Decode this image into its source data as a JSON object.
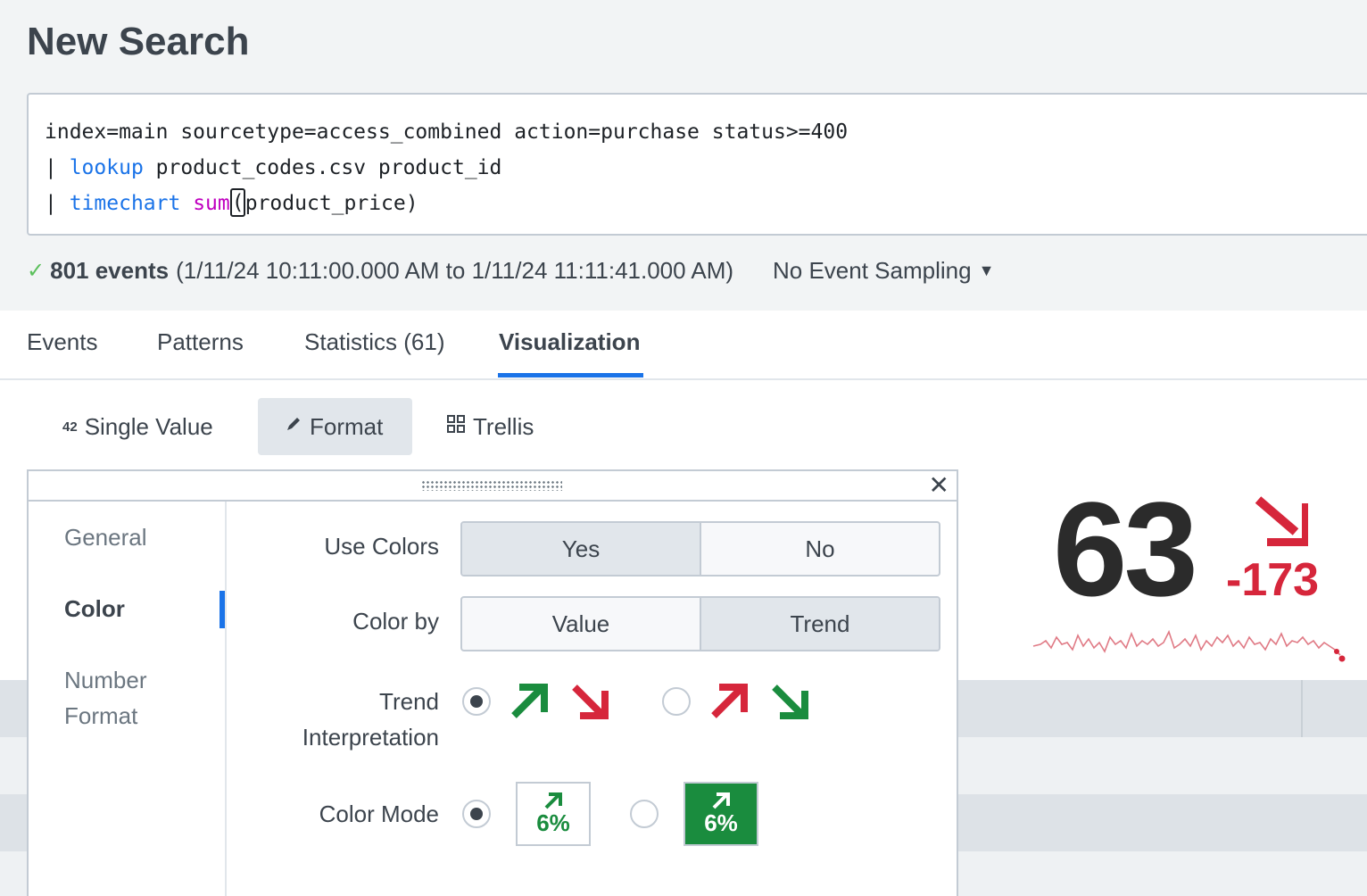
{
  "page": {
    "title": "New Search"
  },
  "search": {
    "line1": "index=main sourcetype=access_combined action=purchase status>=400",
    "line2_pipe": "| ",
    "line2_cmd": "lookup",
    "line2_rest": " product_codes.csv product_id",
    "line3_pipe": "| ",
    "line3_cmd": "timechart",
    "line3_fn": "sum",
    "line3_paren": "(",
    "line3_rest": "product_price)"
  },
  "status": {
    "count": "801 events",
    "range": "(1/11/24 10:11:00.000 AM to 1/11/24 11:11:41.000 AM)",
    "sampling": "No Event Sampling"
  },
  "tabs": [
    {
      "label": "Events"
    },
    {
      "label": "Patterns"
    },
    {
      "label": "Statistics (61)"
    },
    {
      "label": "Visualization",
      "active": true
    }
  ],
  "viz_toolbar": {
    "single_value_badge": "42",
    "single_value": "Single Value",
    "format": "Format",
    "trellis": "Trellis"
  },
  "single_value": {
    "value": "63",
    "delta": "-173",
    "trend_direction": "down",
    "trend_color": "#d6263b"
  },
  "format_panel": {
    "nav": [
      {
        "label": "General"
      },
      {
        "label": "Color",
        "active": true
      },
      {
        "label": "Number Format"
      }
    ],
    "use_colors": {
      "label": "Use Colors",
      "options": [
        "Yes",
        "No"
      ],
      "selected": "Yes"
    },
    "color_by": {
      "label": "Color by",
      "options": [
        "Value",
        "Trend"
      ],
      "selected": "Trend"
    },
    "trend_interpretation": {
      "label": "Trend Interpretation",
      "selected_index": 0,
      "options": [
        {
          "up_color": "#1a8c3e",
          "down_color": "#d6263b"
        },
        {
          "up_color": "#d6263b",
          "down_color": "#1a8c3e"
        }
      ]
    },
    "color_mode": {
      "label": "Color Mode",
      "selected_index": 0,
      "sample_value": "6%",
      "options": [
        "text",
        "block"
      ]
    }
  },
  "colors": {
    "accent": "#1a73e8",
    "green": "#1a8c3e",
    "red": "#d6263b",
    "keyword": "#1a73e8",
    "function": "#c000c0"
  }
}
